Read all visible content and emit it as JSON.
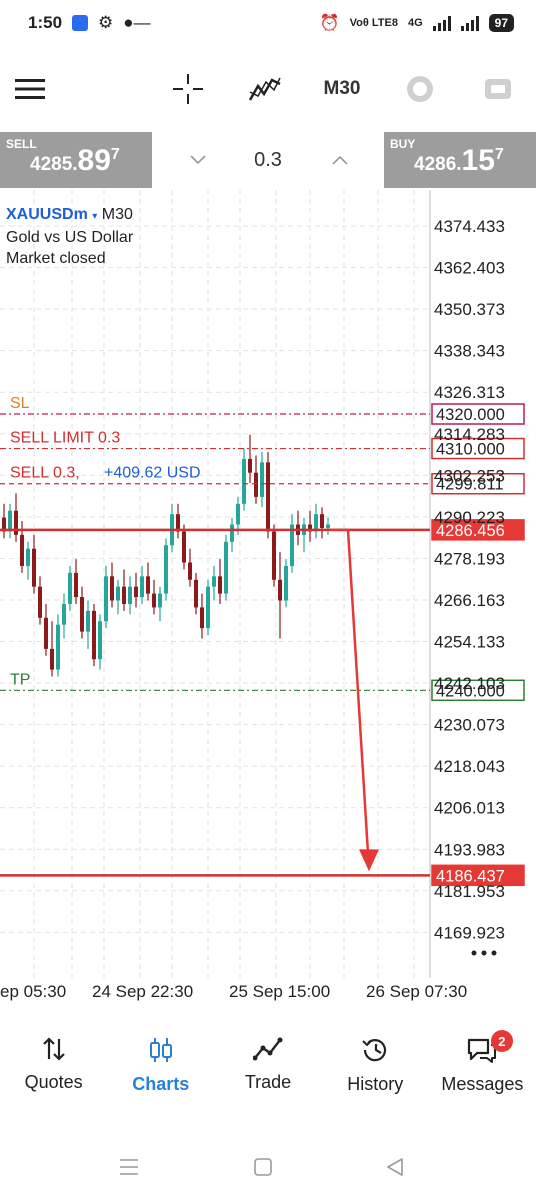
{
  "status_bar": {
    "time": "1:50",
    "network": "Voθ LTE8",
    "signal": "4G",
    "battery": "97"
  },
  "toolbar": {
    "timeframe": "M30"
  },
  "trade": {
    "sell_label": "SELL",
    "sell_price_main": "4285.",
    "sell_price_big": "89",
    "sell_price_sup": "7",
    "lot": "0.3",
    "buy_label": "BUY",
    "buy_price_main": "4286.",
    "buy_price_big": "15",
    "buy_price_sup": "7"
  },
  "chart": {
    "symbol": "XAUUSDm",
    "caret": "▾",
    "timeframe": "M30",
    "description": "Gold vs US Dollar",
    "market_status": "Market closed",
    "price_ticks": [
      "4374.433",
      "4362.403",
      "4350.373",
      "4338.343",
      "4326.313",
      "4314.283",
      "4302.253",
      "4290.223",
      "4278.193",
      "4266.163",
      "4254.133",
      "4242.103",
      "4230.073",
      "4218.043",
      "4206.013",
      "4193.983",
      "4181.953",
      "4169.923"
    ],
    "levels": {
      "sl_label": "SL",
      "sl_price": "4320.000",
      "sell_limit_label": "SELL LIMIT 0.3",
      "sell_limit_price": "4310.000",
      "sell_label": "SELL 0.3,",
      "sell_profit": "+409.62 USD",
      "sell_price": "4299.811",
      "current_price": "4286.456",
      "tp_label": "TP",
      "tp_price": "4240.000",
      "target_price": "4186.437"
    },
    "dates": [
      "ep 05:30",
      "24 Sep 22:30",
      "25 Sep 15:00",
      "26 Sep 07:30"
    ],
    "colors": {
      "sl": "#c2185b",
      "sell": "#d32f2f",
      "tp": "#2e7d32",
      "profit": "#1c5fd6",
      "bull": "#26a69a",
      "bear": "#8b1a1a"
    }
  },
  "nav": {
    "items": [
      {
        "label": "Quotes"
      },
      {
        "label": "Charts"
      },
      {
        "label": "Trade"
      },
      {
        "label": "History"
      },
      {
        "label": "Messages"
      }
    ],
    "messages_badge": "2"
  }
}
